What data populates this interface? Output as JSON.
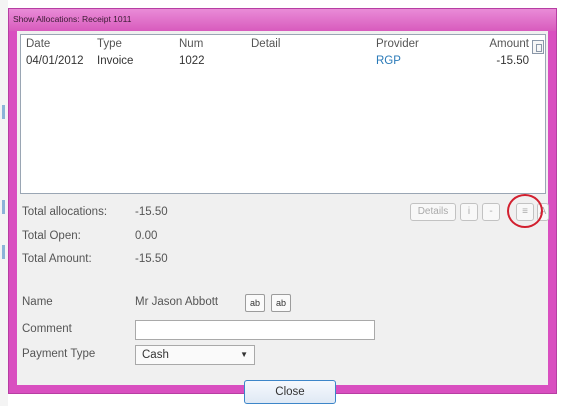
{
  "window": {
    "title": "Show Allocations: Receipt 1011"
  },
  "list": {
    "columns": {
      "date": "Date",
      "type": "Type",
      "num": "Num",
      "detail": "Detail",
      "provider": "Provider",
      "amount": "Amount"
    },
    "rows": [
      {
        "date": "04/01/2012",
        "type": "Invoice",
        "num": "1022",
        "detail": "",
        "provider": "RGP",
        "amount": "-15.50"
      }
    ]
  },
  "summary": {
    "total_allocations_label": "Total allocations:",
    "total_allocations_value": "-15.50",
    "total_open_label": "Total Open:",
    "total_open_value": "0.00",
    "total_amount_label": "Total Amount:",
    "total_amount_value": "-15.50"
  },
  "nav": {
    "details_label": "Details",
    "info_label": "i",
    "dash_label": "-",
    "list_label": "≡",
    "last_label": "A"
  },
  "form": {
    "name_label": "Name",
    "name_value": "Mr Jason Abbott",
    "btn1_label": "ab",
    "btn2_label": "ab",
    "comment_label": "Comment",
    "comment_value": "",
    "payment_type_label": "Payment Type",
    "payment_type_value": "Cash"
  },
  "footer": {
    "close_label": "Close"
  },
  "colors": {
    "titlebar": "#d94fc0",
    "highlight_circle": "#d2202f",
    "link": "#2a7ab8"
  }
}
